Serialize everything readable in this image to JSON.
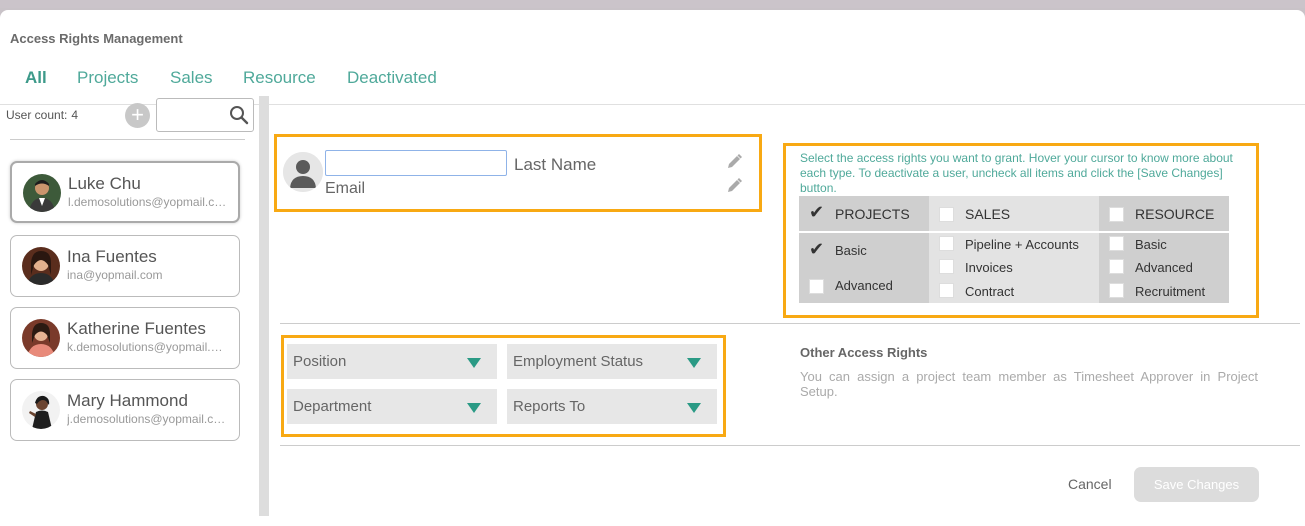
{
  "header": {
    "title": "Access Rights Management"
  },
  "tabs": [
    {
      "label": "All",
      "active": true
    },
    {
      "label": "Projects"
    },
    {
      "label": "Sales"
    },
    {
      "label": "Resource"
    },
    {
      "label": "Deactivated"
    }
  ],
  "sidebar": {
    "user_count_label": "User count:",
    "user_count": "4",
    "add_icon": "plus-icon",
    "search_icon": "search-icon",
    "search_placeholder": "",
    "users": [
      {
        "name": "Luke Chu",
        "email": "l.demosolutions@yopmail.com",
        "selected": true
      },
      {
        "name": "Ina Fuentes",
        "email": "ina@yopmail.com"
      },
      {
        "name": "Katherine Fuentes",
        "email": "k.demosolutions@yopmail.com"
      },
      {
        "name": "Mary Hammond",
        "email": "j.demosolutions@yopmail.com"
      }
    ]
  },
  "profile": {
    "first_name_value": "",
    "last_name_label": "Last Name",
    "email_label": "Email",
    "edit_icon": "pencil-icon"
  },
  "rights": {
    "instructions": "Select the access rights you want to grant. Hover your cursor to know more about each type. To deactivate a user, uncheck all items and click the [Save Changes] button.",
    "groups": [
      {
        "heading": "PROJECTS",
        "checked": true,
        "items": [
          {
            "label": "Basic",
            "checked": true
          },
          {
            "label": "Advanced",
            "checked": false
          }
        ]
      },
      {
        "heading": "SALES",
        "checked": false,
        "items": [
          {
            "label": "Pipeline + Accounts",
            "checked": false
          },
          {
            "label": "Invoices",
            "checked": false
          },
          {
            "label": "Contract",
            "checked": false
          }
        ]
      },
      {
        "heading": "RESOURCE",
        "checked": false,
        "items": [
          {
            "label": "Basic",
            "checked": false
          },
          {
            "label": "Advanced",
            "checked": false
          },
          {
            "label": "Recruitment",
            "checked": false
          }
        ]
      }
    ]
  },
  "fields": {
    "position": "Position",
    "employment_status": "Employment Status",
    "department": "Department",
    "reports_to": "Reports To"
  },
  "other": {
    "title": "Other Access Rights",
    "text": "You can assign a project team member as Timesheet Approver in Project Setup."
  },
  "actions": {
    "cancel": "Cancel",
    "save": "Save Changes"
  },
  "colors": {
    "accent": "#4fa99a",
    "highlight": "#f8a913",
    "arrow": "#2a9a85"
  }
}
